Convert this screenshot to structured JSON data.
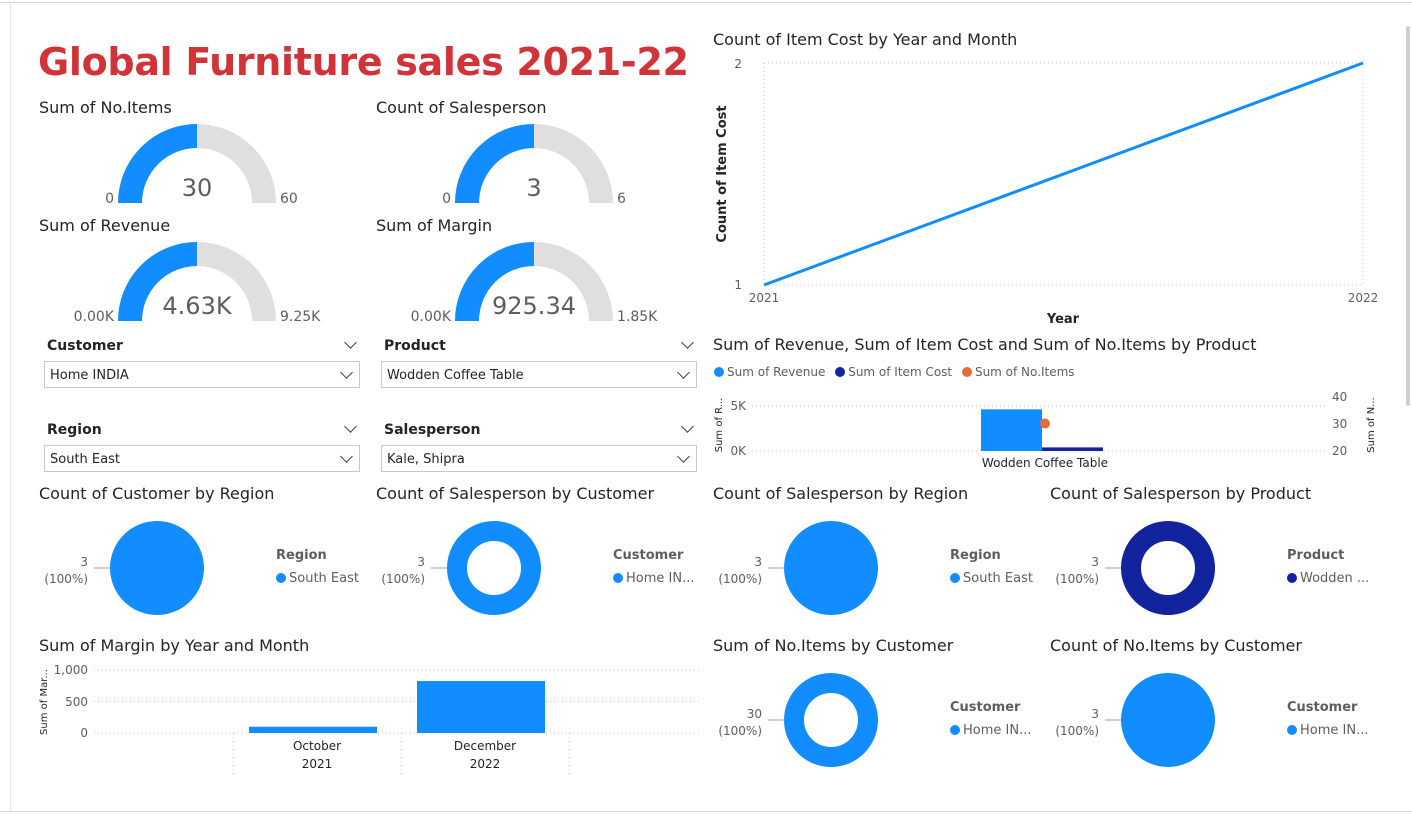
{
  "title": "Global Furniture sales 2021-22",
  "colors": {
    "primary": "#118dff",
    "dark_blue": "#12239e",
    "orange": "#e66c37",
    "gauge_bg": "#e1dfdd",
    "title_red": "#d13438"
  },
  "gauges": [
    {
      "title": "Sum of No.Items",
      "value": 30,
      "display": "30",
      "min": "0",
      "max": "60",
      "fraction": 0.5
    },
    {
      "title": "Count of Salesperson",
      "value": 3,
      "display": "3",
      "min": "0",
      "max": "6",
      "fraction": 0.5
    },
    {
      "title": "Sum of Revenue",
      "value": 4630,
      "display": "4.63K",
      "min": "0.00K",
      "max": "9.25K",
      "fraction": 0.5
    },
    {
      "title": "Sum of Margin",
      "value": 925.34,
      "display": "925.34",
      "min": "0.00K",
      "max": "1.85K",
      "fraction": 0.5
    }
  ],
  "slicers": [
    {
      "title": "Customer",
      "value": "Home INDIA"
    },
    {
      "title": "Product",
      "value": "Wodden Coffee Table"
    },
    {
      "title": "Region",
      "value": "South East"
    },
    {
      "title": "Salesperson",
      "value": "Kale, Shipra"
    }
  ],
  "line_chart": {
    "title": "Count of Item Cost by Year and Month",
    "xlabel": "Year",
    "ylabel": "Count of Item Cost",
    "y_ticks": [
      "1",
      "2"
    ],
    "x_ticks": [
      "2021",
      "2022"
    ]
  },
  "combo_chart": {
    "title": "Sum of Revenue, Sum of Item Cost and Sum of No.Items by Product",
    "legend": [
      "Sum of Revenue",
      "Sum of Item Cost",
      "Sum of No.Items"
    ],
    "y_left_label": "Sum of R...",
    "y_right_label": "Sum of N...",
    "y_left_ticks": [
      "5K",
      "0K"
    ],
    "y_right_ticks": [
      "40",
      "30",
      "20"
    ],
    "category": "Wodden Coffee Table"
  },
  "pies": [
    {
      "title": "Count of Customer by Region",
      "value_label": "3",
      "pct_label": "(100%)",
      "legend_title": "Region",
      "legend_item": "South East",
      "kind": "pie",
      "color": "#118dff"
    },
    {
      "title": "Count of Salesperson by Customer",
      "value_label": "3",
      "pct_label": "(100%)",
      "legend_title": "Customer",
      "legend_item": "Home IN...",
      "kind": "donut",
      "color": "#118dff"
    },
    {
      "title": "Count of Salesperson by Region",
      "value_label": "3",
      "pct_label": "(100%)",
      "legend_title": "Region",
      "legend_item": "South East",
      "kind": "pie",
      "color": "#118dff"
    },
    {
      "title": "Count of Salesperson by Product",
      "value_label": "3",
      "pct_label": "(100%)",
      "legend_title": "Product",
      "legend_item": "Wodden ...",
      "kind": "donut",
      "color": "#12239e"
    },
    {
      "title": "Sum of No.Items by Customer",
      "value_label": "30",
      "pct_label": "(100%)",
      "legend_title": "Customer",
      "legend_item": "Home IN...",
      "kind": "donut",
      "color": "#118dff"
    },
    {
      "title": "Count of No.Items by Customer",
      "value_label": "3",
      "pct_label": "(100%)",
      "legend_title": "Customer",
      "legend_item": "Home IN...",
      "kind": "pie",
      "color": "#118dff"
    }
  ],
  "margin_chart": {
    "title": "Sum of Margin by Year and Month",
    "ylabel": "Sum of Mar...",
    "y_ticks": [
      "1,000",
      "500",
      "0"
    ],
    "months": [
      "October",
      "December"
    ],
    "years": [
      "2021",
      "2022"
    ]
  },
  "chart_data": [
    {
      "type": "line",
      "title": "Count of Item Cost by Year and Month",
      "xlabel": "Year",
      "ylabel": "Count of Item Cost",
      "x": [
        "2021",
        "2022"
      ],
      "values": [
        1,
        2
      ],
      "ylim": [
        1,
        2
      ]
    },
    {
      "type": "bar",
      "title": "Sum of Revenue, Sum of Item Cost and Sum of No.Items by Product",
      "categories": [
        "Wodden Coffee Table"
      ],
      "series": [
        {
          "name": "Sum of Revenue",
          "values": [
            4630
          ]
        },
        {
          "name": "Sum of Item Cost",
          "values": [
            400
          ]
        },
        {
          "name": "Sum of No.Items",
          "values": [
            30
          ],
          "axis": "right",
          "marker": "point"
        }
      ],
      "ylim": [
        0,
        5000
      ],
      "y2lim": [
        20,
        40
      ]
    },
    {
      "type": "bar",
      "title": "Sum of Margin by Year and Month",
      "categories": [
        "October 2021",
        "December 2022"
      ],
      "values": [
        100,
        825
      ],
      "ylim": [
        0,
        1000
      ],
      "ylabel": "Sum of Mar..."
    },
    {
      "type": "pie",
      "title": "Count of Customer by Region",
      "categories": [
        "South East"
      ],
      "values": [
        3
      ]
    },
    {
      "type": "pie",
      "title": "Count of Salesperson by Customer",
      "categories": [
        "Home IN..."
      ],
      "values": [
        3
      ]
    },
    {
      "type": "pie",
      "title": "Count of Salesperson by Region",
      "categories": [
        "South East"
      ],
      "values": [
        3
      ]
    },
    {
      "type": "pie",
      "title": "Count of Salesperson by Product",
      "categories": [
        "Wodden ..."
      ],
      "values": [
        3
      ]
    },
    {
      "type": "pie",
      "title": "Sum of No.Items by Customer",
      "categories": [
        "Home IN..."
      ],
      "values": [
        30
      ]
    },
    {
      "type": "pie",
      "title": "Count of No.Items by Customer",
      "categories": [
        "Home IN..."
      ],
      "values": [
        3
      ]
    }
  ]
}
